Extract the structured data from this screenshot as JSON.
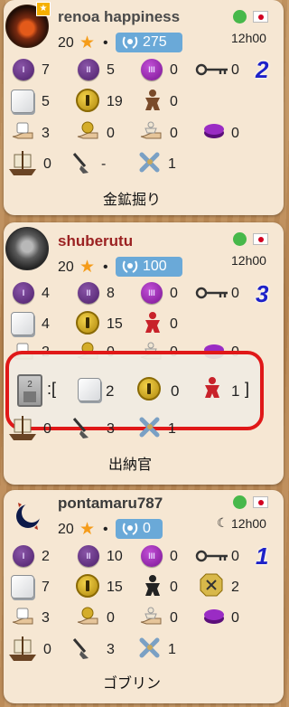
{
  "players": [
    {
      "name": "renoa happiness",
      "score": "20",
      "elo": "275",
      "time": "12h00",
      "rank": "2",
      "job": "金鉱掘り",
      "r1": [
        "7",
        "5",
        "0",
        "0"
      ],
      "r2": [
        "5",
        "19",
        "0"
      ],
      "r3": [
        "3",
        "0",
        "0",
        "0"
      ],
      "r4": [
        "0",
        "-",
        "1"
      ]
    },
    {
      "name": "shuberutu",
      "score": "20",
      "elo": "100",
      "time": "12h00",
      "rank": "3",
      "job": "出納官",
      "r1": [
        "4",
        "8",
        "0",
        "0"
      ],
      "r2": [
        "4",
        "15",
        "0"
      ],
      "r3": [
        "2",
        "0",
        "0",
        "0"
      ],
      "r4": [
        "0",
        "3",
        "1"
      ],
      "highlight": {
        "open": ":[",
        "cube": "2",
        "gold": "0",
        "meeple": "1",
        "close": "]"
      }
    },
    {
      "name": "pontamaru787",
      "score": "20",
      "elo": "0",
      "time": "12h00",
      "rank": "1",
      "job": "ゴブリン",
      "r1": [
        "2",
        "10",
        "0",
        "0"
      ],
      "r2": [
        "7",
        "15",
        "0",
        "2"
      ],
      "r3": [
        "3",
        "0",
        "0",
        "0"
      ],
      "r4": [
        "0",
        "3",
        "1"
      ]
    }
  ],
  "dot_label": "•",
  "icons": [
    "purple-coin-I-icon",
    "purple-coin-II-icon",
    "purple-coin-III-icon",
    "key-icon",
    "white-cube-icon",
    "gold-coin-icon",
    "meeple-icon",
    "hand-icon",
    "purple-disc-icon",
    "ship-icon",
    "shovel-icon",
    "tool-icon",
    "crossed-coin-icon",
    "moon-icon",
    "flag-japan-icon",
    "online-dot-icon",
    "star-icon",
    "laurel-icon"
  ],
  "colors": {
    "online": "#47b84a",
    "elo_badge": "#6aa9d8",
    "rank": "#1e22c8",
    "highlight_border": "#e01818",
    "player2_name": "#9b2222"
  }
}
